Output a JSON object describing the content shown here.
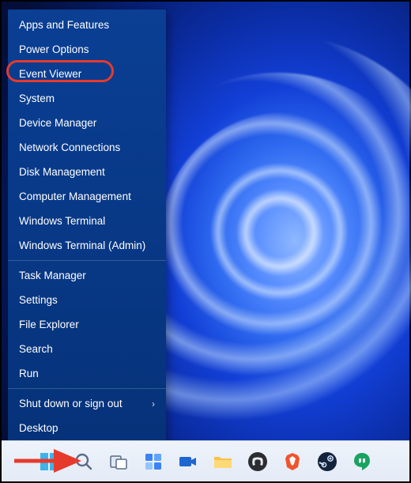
{
  "menu": {
    "groups": [
      [
        {
          "label": "Apps and Features",
          "submenu": false,
          "name": "menu-item-apps-and-features"
        },
        {
          "label": "Power Options",
          "submenu": false,
          "name": "menu-item-power-options"
        },
        {
          "label": "Event Viewer",
          "submenu": false,
          "name": "menu-item-event-viewer",
          "highlighted": true
        },
        {
          "label": "System",
          "submenu": false,
          "name": "menu-item-system"
        },
        {
          "label": "Device Manager",
          "submenu": false,
          "name": "menu-item-device-manager"
        },
        {
          "label": "Network Connections",
          "submenu": false,
          "name": "menu-item-network-connections"
        },
        {
          "label": "Disk Management",
          "submenu": false,
          "name": "menu-item-disk-management"
        },
        {
          "label": "Computer Management",
          "submenu": false,
          "name": "menu-item-computer-management"
        },
        {
          "label": "Windows Terminal",
          "submenu": false,
          "name": "menu-item-windows-terminal"
        },
        {
          "label": "Windows Terminal (Admin)",
          "submenu": false,
          "name": "menu-item-windows-terminal-admin"
        }
      ],
      [
        {
          "label": "Task Manager",
          "submenu": false,
          "name": "menu-item-task-manager"
        },
        {
          "label": "Settings",
          "submenu": false,
          "name": "menu-item-settings"
        },
        {
          "label": "File Explorer",
          "submenu": false,
          "name": "menu-item-file-explorer"
        },
        {
          "label": "Search",
          "submenu": false,
          "name": "menu-item-search"
        },
        {
          "label": "Run",
          "submenu": false,
          "name": "menu-item-run"
        }
      ],
      [
        {
          "label": "Shut down or sign out",
          "submenu": true,
          "name": "menu-item-shut-down-or-sign-out"
        },
        {
          "label": "Desktop",
          "submenu": false,
          "name": "menu-item-desktop"
        }
      ]
    ]
  },
  "taskbar": {
    "items": [
      {
        "name": "start-button",
        "icon": "windows-logo-icon"
      },
      {
        "name": "search-button",
        "icon": "search-icon"
      },
      {
        "name": "task-view-button",
        "icon": "task-view-icon"
      },
      {
        "name": "widgets-button",
        "icon": "widgets-icon"
      },
      {
        "name": "app-video",
        "icon": "camera-icon"
      },
      {
        "name": "app-file-explorer",
        "icon": "folder-icon"
      },
      {
        "name": "app-discord",
        "icon": "discord-icon"
      },
      {
        "name": "app-brave",
        "icon": "brave-icon"
      },
      {
        "name": "app-steam",
        "icon": "steam-icon"
      },
      {
        "name": "app-hangouts",
        "icon": "hangouts-icon"
      }
    ]
  },
  "annotations": {
    "arrow_target": "start-button",
    "oval_target": "menu-item-event-viewer"
  }
}
